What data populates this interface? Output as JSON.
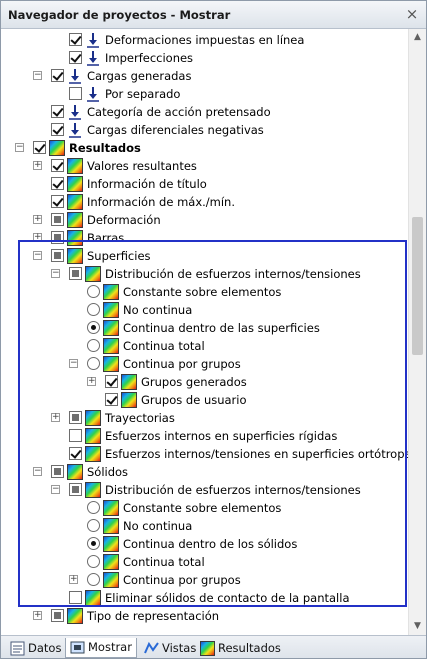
{
  "window": {
    "title": "Navegador de proyectos - Mostrar",
    "close_glyph": "×"
  },
  "tree": [
    {
      "level": 3,
      "expander": "",
      "check": "checked",
      "icon": "load-icon",
      "label": "Deformaciones impuestas en línea"
    },
    {
      "level": 3,
      "expander": "",
      "check": "checked",
      "icon": "load-icon",
      "label": "Imperfecciones"
    },
    {
      "level": 2,
      "expander": "-",
      "check": "checked",
      "icon": "load-icon",
      "label": "Cargas generadas"
    },
    {
      "level": 3,
      "expander": "",
      "check": "unchecked",
      "icon": "load-icon",
      "label": "Por separado"
    },
    {
      "level": 2,
      "expander": "",
      "check": "checked",
      "icon": "load-icon",
      "label": "Categoría de acción pretensado"
    },
    {
      "level": 2,
      "expander": "",
      "check": "checked",
      "icon": "load-icon",
      "label": "Cargas diferenciales negativas"
    },
    {
      "level": 1,
      "expander": "-",
      "check": "checked",
      "icon": "result-icon",
      "label": "Resultados",
      "bold": true
    },
    {
      "level": 2,
      "expander": "+",
      "check": "checked",
      "icon": "result-icon",
      "label": "Valores resultantes"
    },
    {
      "level": 2,
      "expander": "",
      "check": "checked",
      "icon": "result-icon",
      "label": "Información de título"
    },
    {
      "level": 2,
      "expander": "",
      "check": "checked",
      "icon": "result-icon",
      "label": "Información de máx./mín."
    },
    {
      "level": 2,
      "expander": "+",
      "check": "partial",
      "icon": "result-icon",
      "label": "Deformación"
    },
    {
      "level": 2,
      "expander": "+",
      "check": "partial",
      "icon": "result-icon",
      "label": "Barras"
    },
    {
      "level": 2,
      "expander": "-",
      "check": "partial",
      "icon": "result-icon",
      "label": "Superficies"
    },
    {
      "level": 3,
      "expander": "-",
      "check": "partial",
      "icon": "result-icon",
      "label": "Distribución de esfuerzos internos/tensiones"
    },
    {
      "level": 4,
      "expander": "",
      "radio": "unchecked",
      "icon": "result-icon",
      "label": "Constante sobre elementos"
    },
    {
      "level": 4,
      "expander": "",
      "radio": "unchecked",
      "icon": "result-icon",
      "label": "No continua"
    },
    {
      "level": 4,
      "expander": "",
      "radio": "checked",
      "icon": "result-icon",
      "label": "Continua dentro de las superficies"
    },
    {
      "level": 4,
      "expander": "",
      "radio": "unchecked",
      "icon": "result-icon",
      "label": "Continua total"
    },
    {
      "level": 4,
      "expander": "-",
      "radio": "unchecked",
      "icon": "result-icon",
      "label": "Continua por grupos"
    },
    {
      "level": 5,
      "expander": "+",
      "check": "checked",
      "icon": "result-icon",
      "label": "Grupos generados"
    },
    {
      "level": 5,
      "expander": "",
      "check": "checked",
      "icon": "result-icon",
      "label": "Grupos de usuario"
    },
    {
      "level": 3,
      "expander": "+",
      "check": "partial",
      "icon": "result-icon",
      "label": "Trayectorias"
    },
    {
      "level": 3,
      "expander": "",
      "check": "unchecked",
      "icon": "result-icon",
      "label": "Esfuerzos internos en superficies rígidas"
    },
    {
      "level": 3,
      "expander": "",
      "check": "checked",
      "icon": "result-icon",
      "label": "Esfuerzos internos/tensiones en superficies ortótropas"
    },
    {
      "level": 2,
      "expander": "-",
      "check": "partial",
      "icon": "result-icon",
      "label": "Sólidos"
    },
    {
      "level": 3,
      "expander": "-",
      "check": "partial",
      "icon": "result-icon",
      "label": "Distribución de esfuerzos internos/tensiones"
    },
    {
      "level": 4,
      "expander": "",
      "radio": "unchecked",
      "icon": "result-icon",
      "label": "Constante sobre elementos"
    },
    {
      "level": 4,
      "expander": "",
      "radio": "unchecked",
      "icon": "result-icon",
      "label": "No continua"
    },
    {
      "level": 4,
      "expander": "",
      "radio": "checked",
      "icon": "result-icon",
      "label": "Continua dentro de los sólidos"
    },
    {
      "level": 4,
      "expander": "",
      "radio": "unchecked",
      "icon": "result-icon",
      "label": "Continua total"
    },
    {
      "level": 4,
      "expander": "+",
      "radio": "unchecked",
      "icon": "result-icon",
      "label": "Continua por grupos"
    },
    {
      "level": 3,
      "expander": "",
      "check": "unchecked",
      "icon": "result-icon",
      "label": "Eliminar sólidos de contacto de la pantalla"
    },
    {
      "level": 2,
      "expander": "+",
      "check": "partial",
      "icon": "result-icon",
      "label": "Tipo de representación"
    }
  ],
  "tabs": [
    {
      "label": "Datos",
      "icon": "data-icon",
      "active": false
    },
    {
      "label": "Mostrar",
      "icon": "display-icon",
      "active": true
    },
    {
      "label": "Vistas",
      "icon": "views-icon",
      "active": false
    },
    {
      "label": "Resultados",
      "icon": "results-icon",
      "active": false
    }
  ],
  "colors": {
    "highlight": "#2331c7",
    "title_bg": "#dde3ea"
  }
}
